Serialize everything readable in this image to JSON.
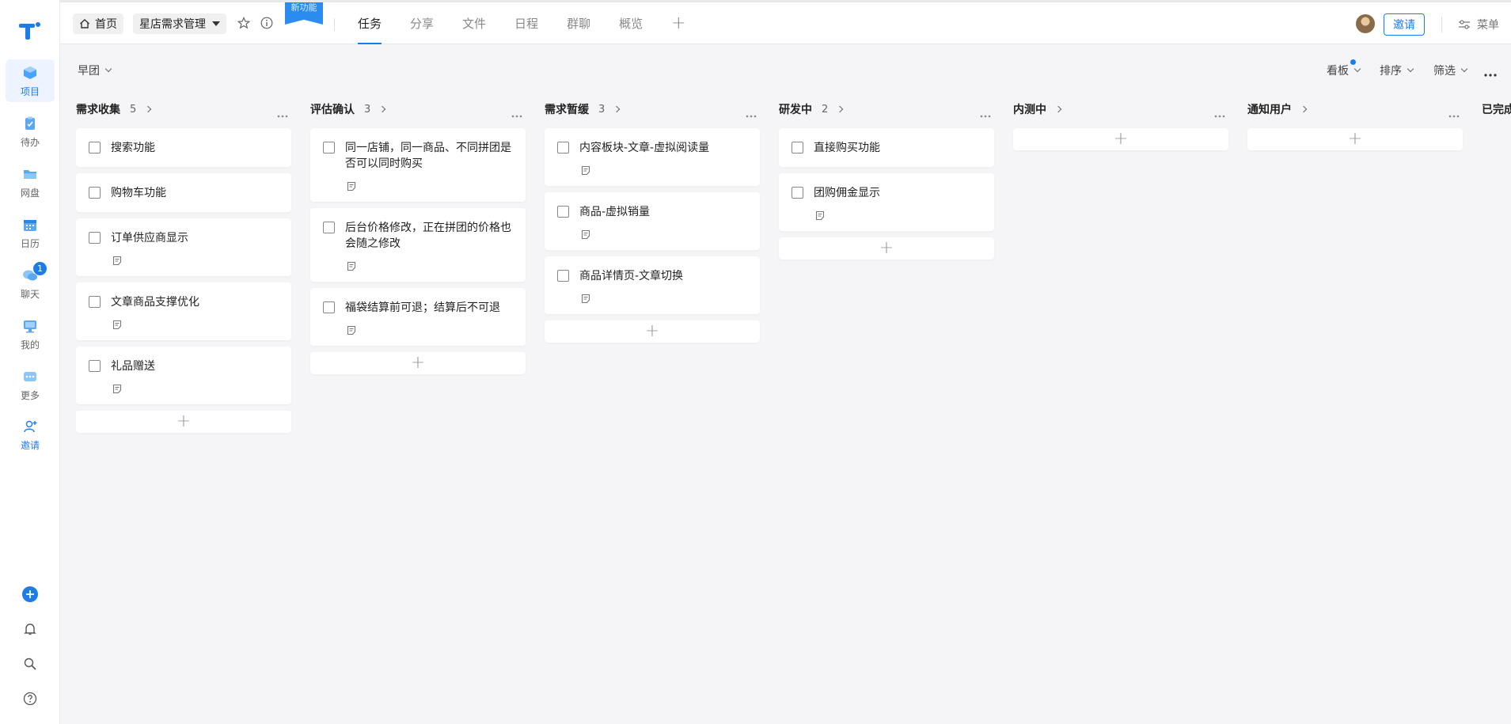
{
  "rail": {
    "items": [
      {
        "label": "项目",
        "icon": "project-icon"
      },
      {
        "label": "待办",
        "icon": "todo-icon"
      },
      {
        "label": "网盘",
        "icon": "drive-icon"
      },
      {
        "label": "日历",
        "icon": "calendar-icon"
      },
      {
        "label": "聊天",
        "icon": "chat-icon",
        "badge": "1"
      },
      {
        "label": "我的",
        "icon": "my-icon"
      },
      {
        "label": "更多",
        "icon": "more-icon"
      },
      {
        "label": "邀请",
        "icon": "invite-user-icon"
      }
    ]
  },
  "topbar": {
    "home_label": "首页",
    "project_label": "星店需求管理",
    "new_feature_label": "新功能",
    "tabs": [
      {
        "label": "任务",
        "active": true
      },
      {
        "label": "分享"
      },
      {
        "label": "文件"
      },
      {
        "label": "日程"
      },
      {
        "label": "群聊"
      },
      {
        "label": "概览"
      }
    ],
    "tab_add": "+",
    "invite_label": "邀请",
    "menu_label": "菜单"
  },
  "subbar": {
    "group_label": "早团",
    "view_label": "看板",
    "sort_label": "排序",
    "filter_label": "筛选"
  },
  "columns": [
    {
      "title": "需求收集",
      "count": "5",
      "cards": [
        {
          "title": "搜索功能",
          "note": false
        },
        {
          "title": "购物车功能",
          "note": false
        },
        {
          "title": "订单供应商显示",
          "note": true
        },
        {
          "title": "文章商品支撑优化",
          "note": true
        },
        {
          "title": "礼品赠送",
          "note": true
        }
      ]
    },
    {
      "title": "评估确认",
      "count": "3",
      "cards": [
        {
          "title": "同一店铺，同一商品、不同拼团是否可以同时购买",
          "note": true
        },
        {
          "title": "后台价格修改，正在拼团的价格也会随之修改",
          "note": true
        },
        {
          "title": "福袋结算前可退；结算后不可退",
          "note": true
        }
      ]
    },
    {
      "title": "需求暂缓",
      "count": "3",
      "cards": [
        {
          "title": "内容板块-文章-虚拟阅读量",
          "note": true
        },
        {
          "title": "商品-虚拟销量",
          "note": true
        },
        {
          "title": "商品详情页-文章切换",
          "note": true
        }
      ]
    },
    {
      "title": "研发中",
      "count": "2",
      "cards": [
        {
          "title": "直接购买功能",
          "note": false
        },
        {
          "title": "团购佣金显示",
          "note": true
        }
      ]
    },
    {
      "title": "内测中",
      "count": "",
      "cards": []
    },
    {
      "title": "通知用户",
      "count": "",
      "cards": []
    },
    {
      "title": "已完成",
      "count": "",
      "cards": []
    }
  ],
  "colors": {
    "accent": "#1e7ce8",
    "background": "#f5f5f7"
  }
}
